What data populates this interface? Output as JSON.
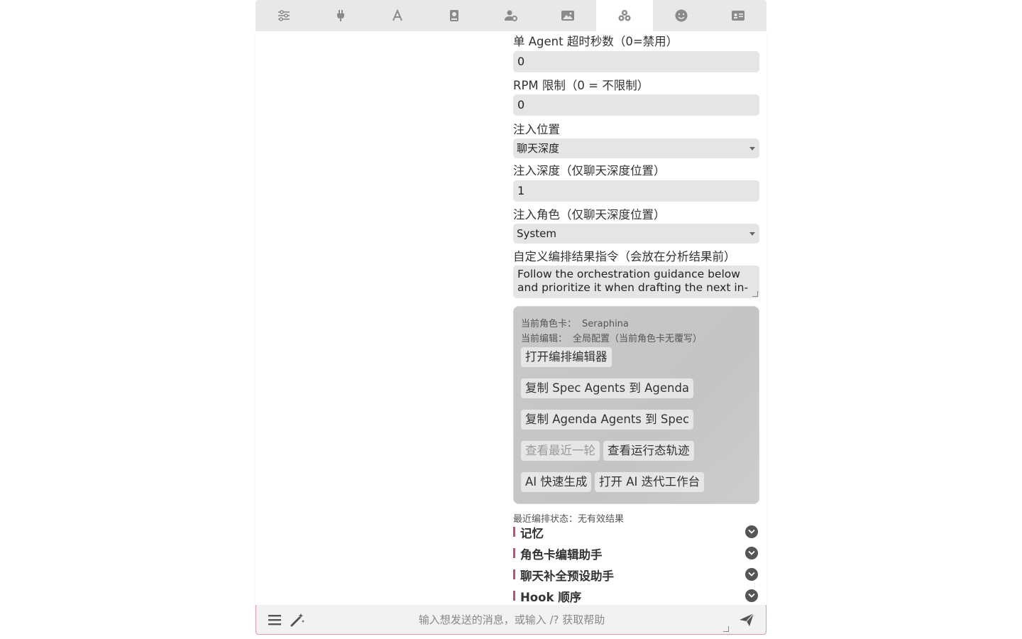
{
  "tabs": [
    {
      "icon": "sliders-icon",
      "active": false
    },
    {
      "icon": "plug-icon",
      "active": false
    },
    {
      "icon": "font-icon",
      "active": false
    },
    {
      "icon": "book-icon",
      "active": false
    },
    {
      "icon": "user-gear-icon",
      "active": false
    },
    {
      "icon": "image-icon",
      "active": false
    },
    {
      "icon": "cubes-icon",
      "active": true
    },
    {
      "icon": "smiley-icon",
      "active": false
    },
    {
      "icon": "id-card-icon",
      "active": false
    }
  ],
  "form": {
    "timeout_label": "单 Agent 超时秒数（0=禁用）",
    "timeout_value": "0",
    "rpm_label": "RPM 限制（0 = 不限制）",
    "rpm_value": "0",
    "position_label": "注入位置",
    "position_value": "聊天深度",
    "depth_label": "注入深度（仅聊天深度位置）",
    "depth_value": "1",
    "role_label": "注入角色（仅聊天深度位置）",
    "role_value": "System",
    "instruction_label": "自定义编排结果指令（会放在分析结果前）",
    "instruction_value": "Follow the orchestration guidance below and prioritize it when drafting the next in-"
  },
  "card": {
    "char_label": "当前角色卡：",
    "char_value": "Seraphina",
    "edit_label": "当前编辑：",
    "edit_value": "全局配置（当前角色卡无覆写）",
    "btn_open_editor": "打开编排编辑器",
    "btn_copy_spec": "复制 Spec Agents 到 Agenda",
    "btn_copy_agenda": "复制 Agenda Agents 到 Spec",
    "btn_view_last": "查看最近一轮",
    "btn_view_trace": "查看运行态轨迹",
    "btn_ai_quick": "AI 快速生成",
    "btn_ai_workbench": "打开 AI 迭代工作台"
  },
  "status_text": "最近编排状态：无有效结果",
  "sections": [
    "记忆",
    "角色卡编辑助手",
    "聊天补全预设助手",
    "Hook 顺序"
  ],
  "input": {
    "placeholder": "输入想发送的消息，或输入 /? 获取帮助"
  },
  "colors": {
    "accent": "#c0506e",
    "field_bg": "#e5e5e5",
    "tabbar_bg": "#e8e8e8"
  }
}
